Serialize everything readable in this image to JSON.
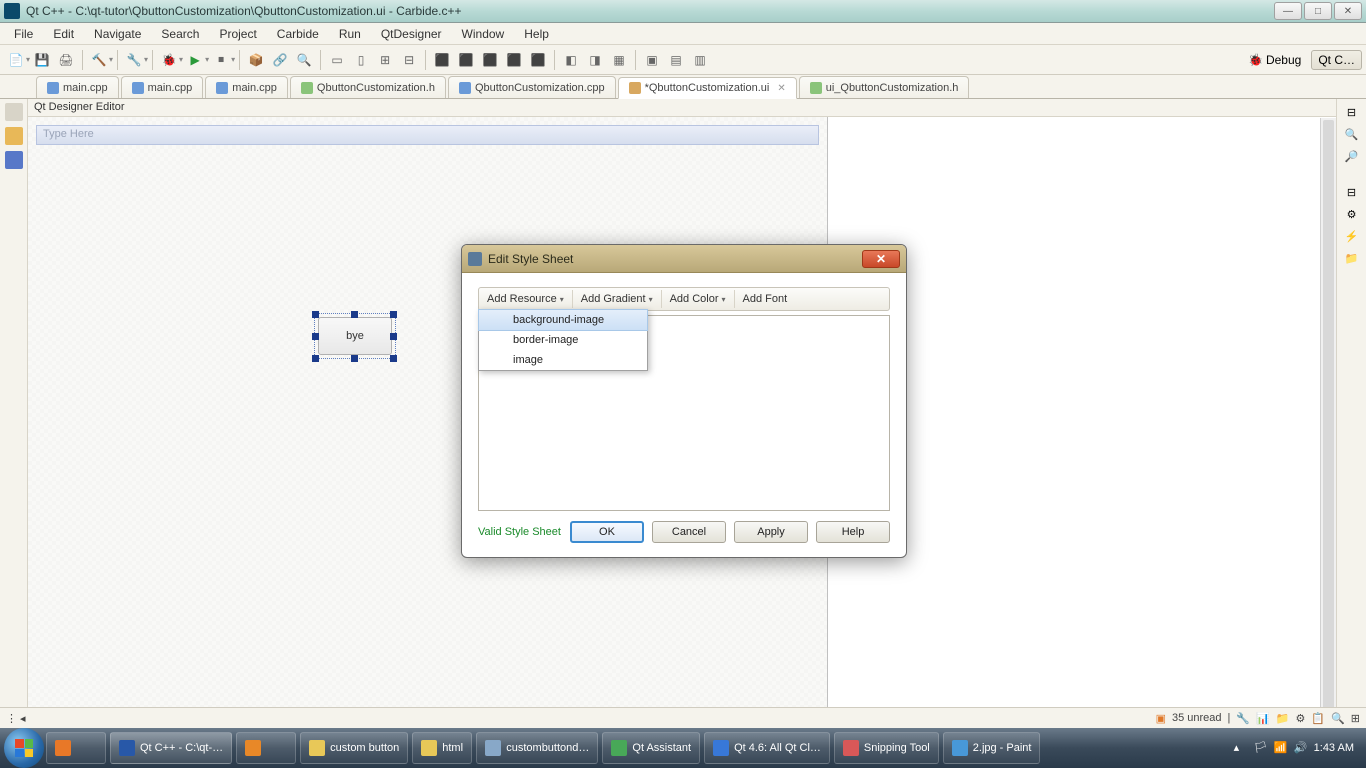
{
  "window": {
    "title": "Qt C++ - C:\\qt-tutor\\QbuttonCustomization\\QbuttonCustomization.ui - Carbide.c++"
  },
  "menu": {
    "items": [
      "File",
      "Edit",
      "Navigate",
      "Search",
      "Project",
      "Carbide",
      "Run",
      "QtDesigner",
      "Window",
      "Help"
    ]
  },
  "toolbar_right": {
    "bug_icon": "🐞",
    "debug": "Debug",
    "qtc": "Qt C…"
  },
  "tabs": [
    {
      "icon": "c",
      "label": "main.cpp",
      "active": false
    },
    {
      "icon": "c",
      "label": "main.cpp",
      "active": false
    },
    {
      "icon": "c",
      "label": "main.cpp",
      "active": false
    },
    {
      "icon": "h",
      "label": "QbuttonCustomization.h",
      "active": false
    },
    {
      "icon": "c",
      "label": "QbuttonCustomization.cpp",
      "active": false
    },
    {
      "icon": "ui",
      "label": "*QbuttonCustomization.ui",
      "active": true,
      "closable": true
    },
    {
      "icon": "h",
      "label": "ui_QbuttonCustomization.h",
      "active": false
    }
  ],
  "editor": {
    "title": "Qt Designer Editor",
    "menu_hint": "Type Here",
    "button_text": "bye"
  },
  "dialog": {
    "title": "Edit Style Sheet",
    "toolbar": {
      "add_resource": "Add Resource",
      "add_gradient": "Add Gradient",
      "add_color": "Add Color",
      "add_font": "Add Font"
    },
    "dropdown": {
      "items": [
        "background-image",
        "border-image",
        "image"
      ],
      "highlighted": 0
    },
    "valid": "Valid Style Sheet",
    "ok": "OK",
    "cancel": "Cancel",
    "apply": "Apply",
    "help": "Help"
  },
  "status": {
    "unread": "35 unread"
  },
  "taskbar": {
    "items": [
      {
        "label": ""
      },
      {
        "label": "Qt C++ - C:\\qt-…",
        "active": true
      },
      {
        "label": ""
      },
      {
        "label": "custom button"
      },
      {
        "label": "html"
      },
      {
        "label": "custombuttond…"
      },
      {
        "label": "Qt Assistant"
      },
      {
        "label": "Qt 4.6: All Qt Cl…"
      },
      {
        "label": "Snipping Tool"
      },
      {
        "label": "2.jpg - Paint"
      }
    ],
    "time": "1:43 AM"
  }
}
